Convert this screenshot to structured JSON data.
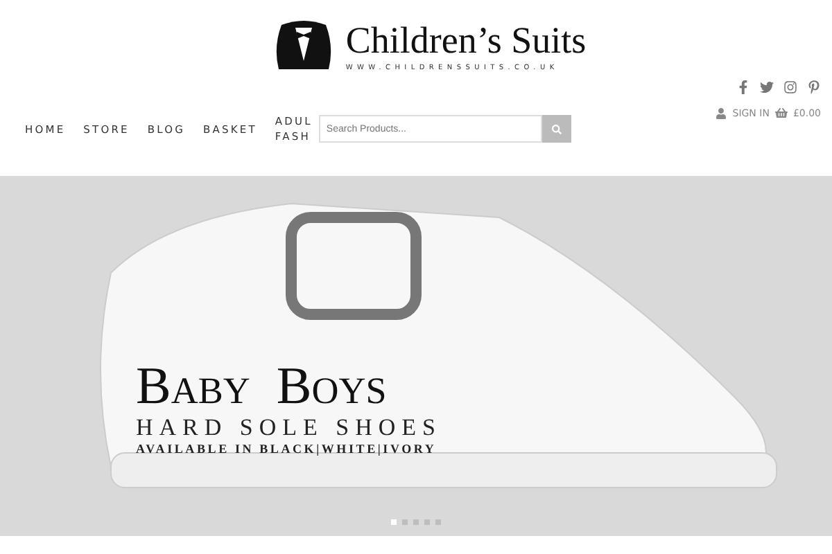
{
  "logo": {
    "name": "Children’s Suits",
    "url": "WWW.CHILDRENSSUITS.CO.UK"
  },
  "nav": [
    {
      "label": "HOME"
    },
    {
      "label": "STORE"
    },
    {
      "label": "BLOG"
    },
    {
      "label": "BASKET"
    },
    {
      "label": "ADUL FASH"
    }
  ],
  "search": {
    "placeholder": "Search Products..."
  },
  "account": {
    "sign_in": "SIGN IN",
    "basket_total": "£0.00"
  },
  "banner": {
    "headline": "Baby  Boys",
    "subtitle": "HARD SOLE SHOES",
    "note": "AVAILABLE IN BLACK|WHITE|IVORY"
  },
  "slider_dots": [
    {
      "selected": true
    },
    {
      "selected": false
    },
    {
      "selected": false
    },
    {
      "selected": false
    },
    {
      "selected": false
    }
  ]
}
